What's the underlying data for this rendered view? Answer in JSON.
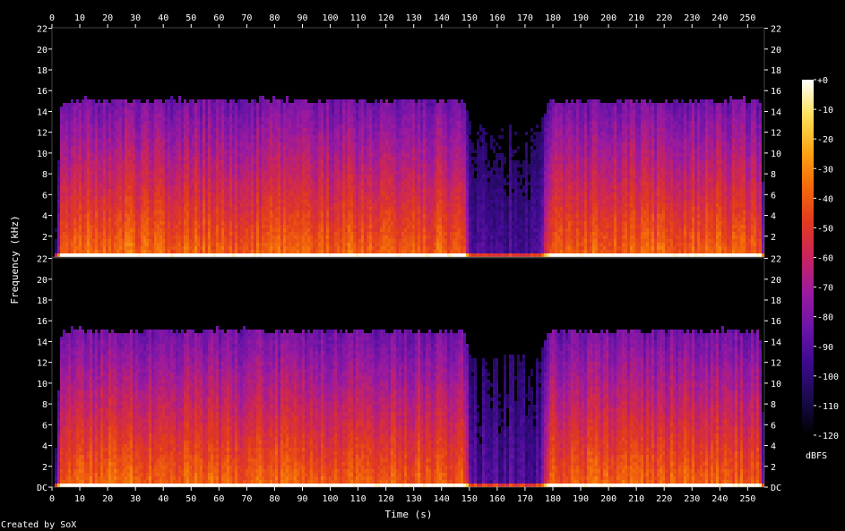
{
  "chart_data": {
    "type": "heatmap",
    "subtype": "spectrogram",
    "channels": 2,
    "xlabel": "Time (s)",
    "ylabel": "Frequency (kHz)",
    "xlim": [
      0,
      256
    ],
    "x_ticks": [
      0,
      10,
      20,
      30,
      40,
      50,
      60,
      70,
      80,
      90,
      100,
      110,
      120,
      130,
      140,
      150,
      160,
      170,
      180,
      190,
      200,
      210,
      220,
      230,
      240,
      250
    ],
    "ylim": [
      0,
      22.05
    ],
    "y_ticks": [
      {
        "value": 0,
        "label": "DC"
      },
      {
        "value": 2,
        "label": "2"
      },
      {
        "value": 4,
        "label": "4"
      },
      {
        "value": 6,
        "label": "6"
      },
      {
        "value": 8,
        "label": "8"
      },
      {
        "value": 10,
        "label": "10"
      },
      {
        "value": 12,
        "label": "12"
      },
      {
        "value": 14,
        "label": "14"
      },
      {
        "value": 16,
        "label": "16"
      },
      {
        "value": 18,
        "label": "18"
      },
      {
        "value": 20,
        "label": "20"
      },
      {
        "value": 22,
        "label": "22"
      }
    ],
    "colorbar": {
      "label": "dBFS",
      "range": [
        -120,
        0
      ],
      "ticks": [
        {
          "value": 0,
          "label": "+0"
        },
        {
          "value": -10,
          "label": "-10"
        },
        {
          "value": -20,
          "label": "-20"
        },
        {
          "value": -30,
          "label": "-30"
        },
        {
          "value": -40,
          "label": "-40"
        },
        {
          "value": -50,
          "label": "-50"
        },
        {
          "value": -60,
          "label": "-60"
        },
        {
          "value": -70,
          "label": "-70"
        },
        {
          "value": -80,
          "label": "-80"
        },
        {
          "value": -90,
          "label": "-90"
        },
        {
          "value": -100,
          "label": "-100"
        },
        {
          "value": -110,
          "label": "-110"
        },
        {
          "value": -120,
          "label": "-120"
        }
      ],
      "colors": [
        "#000000",
        "#1a0a4a",
        "#3b0a8c",
        "#6b14a8",
        "#9a1aa0",
        "#c8245e",
        "#e23a1e",
        "#f46a0a",
        "#fba616",
        "#ffe05a",
        "#ffffff"
      ]
    },
    "energy_profile": {
      "time": [
        0,
        3,
        10,
        30,
        60,
        88,
        92,
        95,
        120,
        148,
        150,
        152,
        175,
        178,
        200,
        230,
        250,
        254,
        256
      ],
      "upper_cutoff_khz": [
        0,
        15.5,
        15.6,
        15.5,
        15.6,
        15.6,
        15.4,
        15.5,
        15.5,
        15.5,
        13.0,
        13.0,
        13.0,
        15.5,
        15.5,
        15.5,
        15.6,
        15.5,
        0
      ],
      "level_dbfs_low_band": [
        -120,
        -40,
        -35,
        -35,
        -38,
        -36,
        -40,
        -38,
        -37,
        -38,
        -90,
        -90,
        -90,
        -38,
        -37,
        -37,
        -38,
        -40,
        -120
      ]
    },
    "quiet_section": {
      "start": 150,
      "end": 175
    }
  },
  "footer": {
    "credit": "Created by SoX"
  }
}
